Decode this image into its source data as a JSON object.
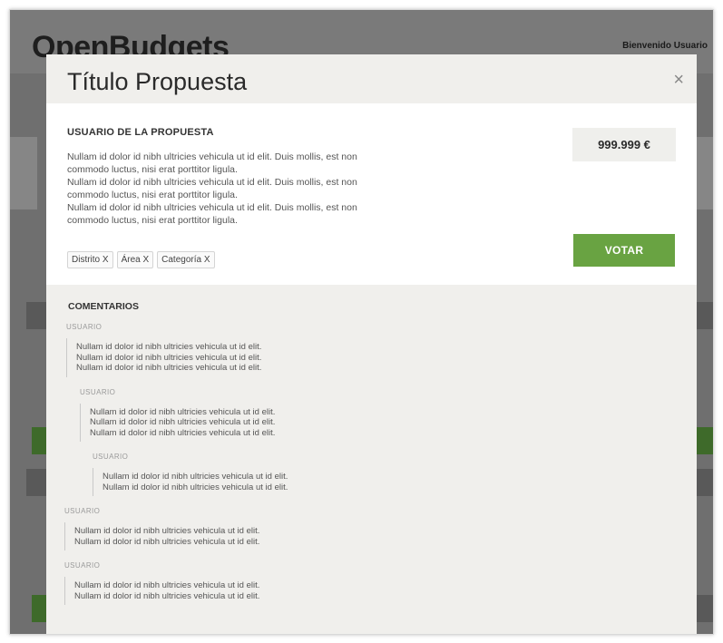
{
  "app": {
    "logo": "OpenBudgets",
    "welcome": "Bienvenido Usuario"
  },
  "modal": {
    "title": "Título Propuesta",
    "close_glyph": "×"
  },
  "proposal": {
    "user_label": "USUARIO DE LA PROPUESTA",
    "description": [
      "Nullam id dolor id nibh ultricies vehicula ut id elit. Duis mollis, est non commodo luctus, nisi erat porttitor ligula.",
      "Nullam id dolor id nibh ultricies vehicula ut id elit. Duis mollis, est non commodo luctus, nisi erat porttitor ligula.",
      "Nullam id dolor id nibh ultricies vehicula ut id elit. Duis mollis, est non commodo luctus, nisi erat porttitor ligula."
    ],
    "tags": [
      "Distrito X",
      "Área X",
      "Categoría X"
    ],
    "price": "999.999 €",
    "vote_label": "VOTAR"
  },
  "comments": {
    "title": "COMENTARIOS",
    "items": [
      {
        "user": "USUARIO",
        "level": 0,
        "lines": [
          "Nullam id dolor id nibh ultricies vehicula ut id elit.",
          "Nullam id dolor id nibh ultricies vehicula ut id elit.",
          "Nullam id dolor id nibh ultricies vehicula ut id elit."
        ]
      },
      {
        "user": "USUARIO",
        "level": 1,
        "lines": [
          "Nullam id dolor id nibh ultricies vehicula ut id elit.",
          "Nullam id dolor id nibh ultricies vehicula ut id elit.",
          "Nullam id dolor id nibh ultricies vehicula ut id elit."
        ]
      },
      {
        "user": "USUARIO",
        "level": 2,
        "lines": [
          "Nullam id dolor id nibh ultricies vehicula ut id elit.",
          "Nullam id dolor id nibh ultricies vehicula ut id elit."
        ]
      },
      {
        "user": "USUARIO",
        "level": -1,
        "lines": [
          "Nullam id dolor id nibh ultricies vehicula ut id elit.",
          "Nullam id dolor id nibh ultricies vehicula ut id elit."
        ]
      },
      {
        "user": "USUARIO",
        "level": -1,
        "lines": [
          "Nullam id dolor id nibh ultricies vehicula ut id elit.",
          "Nullam id dolor id nibh ultricies vehicula ut id elit."
        ]
      }
    ]
  },
  "colors": {
    "accent_green": "#69a342",
    "overlay": "#6f6f6f",
    "modal_bg": "#f0efec"
  }
}
